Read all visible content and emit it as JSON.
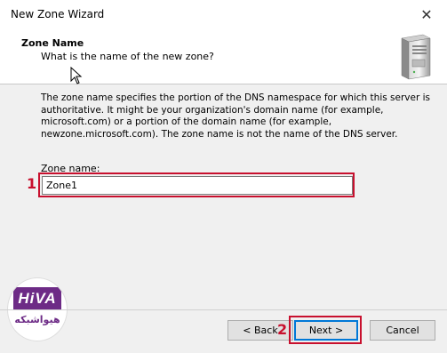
{
  "window": {
    "title": "New Zone Wizard",
    "close_glyph": "✕"
  },
  "header": {
    "title": "Zone Name",
    "subtitle": "What is the name of the new zone?",
    "icon": "server-icon"
  },
  "body": {
    "description": "The zone name specifies the portion of the DNS namespace for which this server is authoritative. It might be your organization's domain name (for example, microsoft.com) or a portion of the domain name (for example, newzone.microsoft.com). The zone name is not the name of the DNS server.",
    "zone_name_label": "Zone name:",
    "zone_name_value": "Zone1"
  },
  "annotations": {
    "marker_1": "1",
    "marker_2": "2",
    "highlight_color": "#c8102e"
  },
  "watermark": {
    "mark": "HiVA",
    "text": "هیواشبکه"
  },
  "buttons": {
    "back": "< Back",
    "next": "Next >",
    "cancel": "Cancel"
  }
}
